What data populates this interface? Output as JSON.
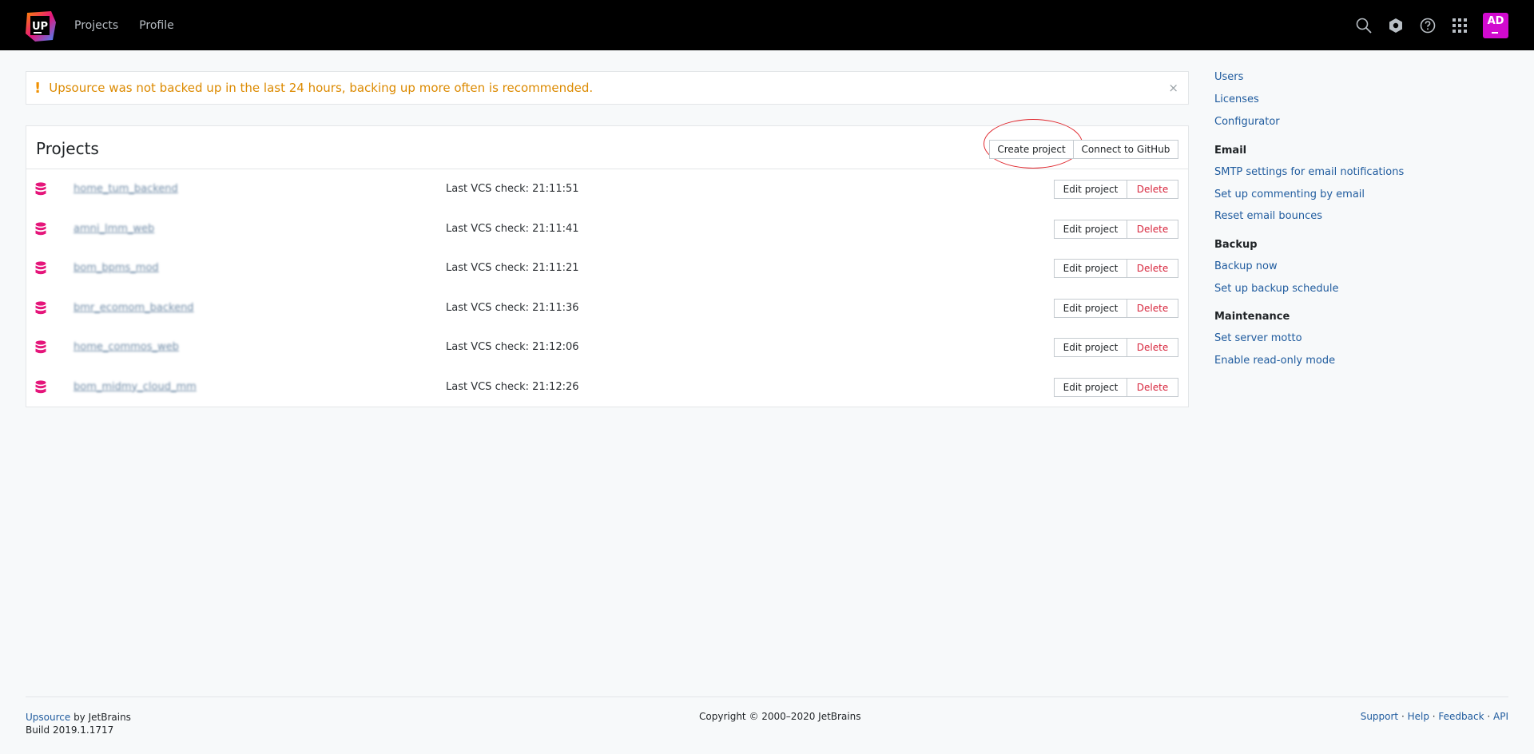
{
  "header": {
    "logo_text": "UP",
    "nav": [
      {
        "label": "Projects"
      },
      {
        "label": "Profile"
      }
    ],
    "avatar_initials": "AD"
  },
  "alert": {
    "mark": "!",
    "text": "Upsource was not backed up in the last 24 hours, backing up more often is recommended.",
    "close": "×"
  },
  "projects": {
    "title": "Projects",
    "create_label": "Create project",
    "github_label": "Connect to GitHub",
    "edit_label": "Edit project",
    "delete_label": "Delete",
    "rows": [
      {
        "name": "home_tum_backend",
        "check": "Last VCS check: 21:11:51"
      },
      {
        "name": "amni_lmm_web",
        "check": "Last VCS check: 21:11:41"
      },
      {
        "name": "bom_bpms_mod",
        "check": "Last VCS check: 21:11:21"
      },
      {
        "name": "bmr_ecomom_backend",
        "check": "Last VCS check: 21:11:36"
      },
      {
        "name": "home_commos_web",
        "check": "Last VCS check: 21:12:06"
      },
      {
        "name": "bom_midmy_cloud_mm",
        "check": "Last VCS check: 21:12:26"
      }
    ]
  },
  "sidebar": {
    "top_links": [
      "Users",
      "Licenses",
      "Configurator"
    ],
    "email": {
      "title": "Email",
      "links": [
        "SMTP settings for email notifications",
        "Set up commenting by email",
        "Reset email bounces"
      ]
    },
    "backup": {
      "title": "Backup",
      "links": [
        "Backup now",
        "Set up backup schedule"
      ]
    },
    "maintenance": {
      "title": "Maintenance",
      "links": [
        "Set server motto",
        "Enable read-only mode"
      ]
    }
  },
  "footer": {
    "product": "Upsource",
    "by": " by JetBrains",
    "build": "Build 2019.1.1717",
    "copyright": "Copyright © 2000–2020 JetBrains",
    "links": [
      "Support",
      "Help",
      "Feedback",
      "API"
    ],
    "separator": " · "
  },
  "colors": {
    "header_bg": "#000000",
    "link": "#1f5b9e",
    "alert_text": "#dc8a00",
    "delete": "#d7263d",
    "db_icon": "#e5157a",
    "avatar": "#d10acf",
    "highlight_ring": "#e0292f"
  }
}
